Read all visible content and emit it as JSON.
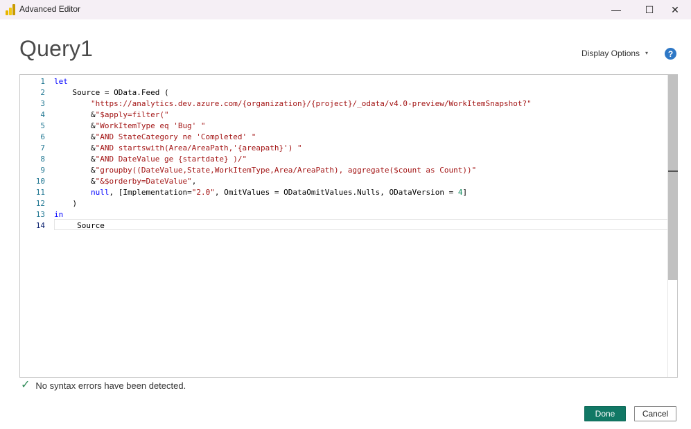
{
  "window": {
    "title": "Advanced Editor",
    "minimize_glyph": "—",
    "maximize_glyph": "☐",
    "close_glyph": "✕"
  },
  "query_title": "Query1",
  "toolbar": {
    "display_options_label": "Display Options",
    "display_options_caret": "▾",
    "help_glyph": "?"
  },
  "editor": {
    "line_numbers": [
      "1",
      "2",
      "3",
      "4",
      "5",
      "6",
      "7",
      "8",
      "9",
      "10",
      "11",
      "12",
      "13",
      "14"
    ],
    "active_line": 14,
    "lines": [
      "let",
      "    Source = OData.Feed (",
      "        \"https://analytics.dev.azure.com/{organization}/{project}/_odata/v4.0-preview/WorkItemSnapshot?\"",
      "        &\"$apply=filter(\"",
      "        &\"WorkItemType eq 'Bug' \"",
      "        &\"AND StateCategory ne 'Completed' \"",
      "        &\"AND startswith(Area/AreaPath,'{areapath}') \"",
      "        &\"AND DateValue ge {startdate} )/\"",
      "        &\"groupby((DateValue,State,WorkItemType,Area/AreaPath), aggregate($count as Count))\"",
      "        &\"&$orderby=DateValue\",",
      "        null, [Implementation=\"2.0\", OmitValues = ODataOmitValues.Nulls, ODataVersion = 4]",
      "    )",
      "in",
      "     Source"
    ]
  },
  "status": {
    "icon": "check-icon",
    "check_glyph": "✓",
    "message": "No syntax errors have been detected."
  },
  "buttons": {
    "done_label": "Done",
    "cancel_label": "Cancel"
  },
  "colors": {
    "accent_done": "#117865",
    "help_blue": "#2e78c6",
    "keyword": "#0000ff",
    "string": "#a31515",
    "number": "#098658",
    "line_number": "#237893"
  }
}
